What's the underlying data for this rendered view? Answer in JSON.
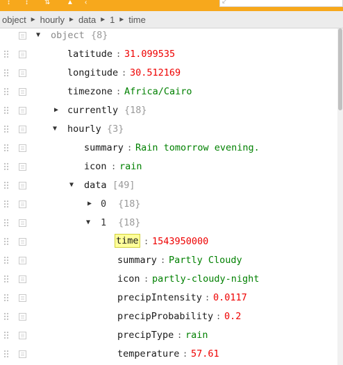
{
  "toolbar": {
    "accent": "#f7a81c",
    "icons": [
      "expand-all-icon",
      "collapse-all-icon",
      "sort-icon",
      "filter-icon",
      "undo-icon"
    ]
  },
  "breadcrumb": {
    "items": [
      "object",
      "hourly",
      "data",
      "1",
      "time"
    ],
    "separator": "►"
  },
  "tree": {
    "toggle_open": "▼",
    "toggle_closed": "▶",
    "colon": ":",
    "rows": [
      {
        "key": "object",
        "meta": "{8}"
      },
      {
        "key": "latitude",
        "value": "31.099535"
      },
      {
        "key": "longitude",
        "value": "30.512169"
      },
      {
        "key": "timezone",
        "value": "Africa/Cairo"
      },
      {
        "key": "currently",
        "meta": "{18}"
      },
      {
        "key": "hourly",
        "meta": "{3}"
      },
      {
        "key": "summary",
        "value": "Rain tomorrow evening."
      },
      {
        "key": "icon",
        "value": "rain"
      },
      {
        "key": "data",
        "meta": "[49]"
      },
      {
        "key": "0",
        "meta": "{18}"
      },
      {
        "key": "1",
        "meta": "{18}"
      },
      {
        "key": "time",
        "value": "1543950000"
      },
      {
        "key": "summary",
        "value": "Partly Cloudy"
      },
      {
        "key": "icon",
        "value": "partly-cloudy-night"
      },
      {
        "key": "precipIntensity",
        "value": "0.0117"
      },
      {
        "key": "precipProbability",
        "value": "0.2"
      },
      {
        "key": "precipType",
        "value": "rain"
      },
      {
        "key": "temperature",
        "value": "57.61"
      }
    ]
  },
  "colors": {
    "number": "#ee0000",
    "string": "#008000",
    "meta": "#999999",
    "selected_key_bg": "#ffff9a"
  }
}
